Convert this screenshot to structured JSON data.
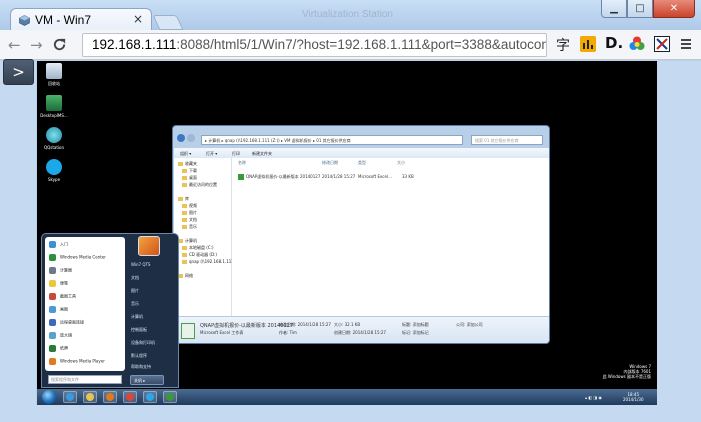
{
  "browser": {
    "tab_title": "VM - Win7",
    "tab_close": "×",
    "window_title": "Virtualization Station",
    "window_controls": {
      "minimize": "▁",
      "maximize": "□",
      "close": "✕"
    },
    "url_host": "192.168.1.111",
    "url_rest": ":8088/html5/1/Win7/?host=192.168.1.111&port=3388&autoconne",
    "extensions": [
      "translate-icon",
      "stats-icon",
      "d-icon",
      "color-wheel-icon",
      "cut-icon"
    ],
    "ext_translate_text": "字",
    "ext_d_text": "D."
  },
  "sidebar": {
    "toggle_label": ">"
  },
  "desktop": {
    "icons": [
      {
        "label": "回收站"
      },
      {
        "label": "DesktopIMS..."
      },
      {
        "label": "QQstation"
      },
      {
        "label": "Skype"
      }
    ]
  },
  "explorer": {
    "address": "▸ 计算机 ▸ qnap (\\\\192.168.1.111 (Z:)) ▸ VM 虚拟机报价 ▸ 01 其它报价供应商",
    "search_placeholder": "搜索 01 其它报价供应商",
    "commands": [
      "组织 ▾",
      "打开 ▾",
      "打印",
      "新建文件夹"
    ],
    "nav": {
      "favorites": [
        "收藏夹",
        "下载",
        "桌面",
        "最近访问的位置"
      ],
      "libraries": [
        "库",
        "视频",
        "图片",
        "文档",
        "音乐"
      ],
      "computer": [
        "计算机",
        "本地磁盘 (C:)",
        "CD 驱动器 (D:)",
        "qnap (\\\\192.168.1.111)"
      ],
      "network": [
        "网络"
      ]
    },
    "columns": [
      "名称",
      "修改日期",
      "类型",
      "大小"
    ],
    "files": [
      {
        "name": "QNAP虚拟机报价-以最新版本 20140127",
        "date": "2014/1/28 15:27",
        "type": "Microsoft Excel...",
        "size": "33 KB"
      }
    ],
    "details": {
      "name": "QNAP虚拟机报价-以最新版本 20140127",
      "kind": "Microsoft Excel 工作表",
      "date_label": "修改日期: 2014/1/28 15:27",
      "author_label": "作者: Tim",
      "size_label": "大小: 32.1 KB",
      "created_label": "创建日期: 2014/1/28 15:27",
      "title_label": "标题: 添加标题",
      "tags_label": "标记: 添加标记",
      "company_label": "公司: 添加公司"
    }
  },
  "startmenu": {
    "left_items": [
      {
        "label": "入门",
        "color": "#3d8fd6"
      },
      {
        "label": "Windows Media Center",
        "color": "#2f8f3a"
      },
      {
        "label": "计算器",
        "color": "#6b7b8c"
      },
      {
        "label": "便笺",
        "color": "#e8c93a"
      },
      {
        "label": "截图工具",
        "color": "#c84a3a"
      },
      {
        "label": "画图",
        "color": "#4a9ad8"
      },
      {
        "label": "远程桌面连接",
        "color": "#3a6ab8"
      },
      {
        "label": "放大镜",
        "color": "#5aa0d0"
      },
      {
        "label": "纸牌",
        "color": "#2a7a3a"
      },
      {
        "label": "Windows Media Player",
        "color": "#e07a20"
      }
    ],
    "all_programs": "所有程序",
    "search_placeholder": "搜索程序和文件",
    "right_items": [
      "Win7 QTS",
      "文档",
      "图片",
      "音乐",
      "计算机",
      "控制面板",
      "设备和打印机",
      "默认程序",
      "帮助和支持"
    ],
    "shutdown": "关机 ▸"
  },
  "taskbar": {
    "pinned": [
      {
        "name": "ie-icon",
        "color": "#3a9ae0"
      },
      {
        "name": "folder-icon",
        "color": "#e8c44a"
      },
      {
        "name": "media-player-icon",
        "color": "#e07a20"
      },
      {
        "name": "chrome-icon",
        "color": "#d8483a"
      },
      {
        "name": "skype-icon",
        "color": "#2aa8e8"
      },
      {
        "name": "excel-icon",
        "color": "#3a9a3a"
      }
    ],
    "time": "18:45",
    "date": "2014/1/30"
  },
  "watermark": {
    "line1": "Windows 7",
    "line2": "内部版本 7601",
    "line3": "此 Windows 副本不是正版"
  }
}
